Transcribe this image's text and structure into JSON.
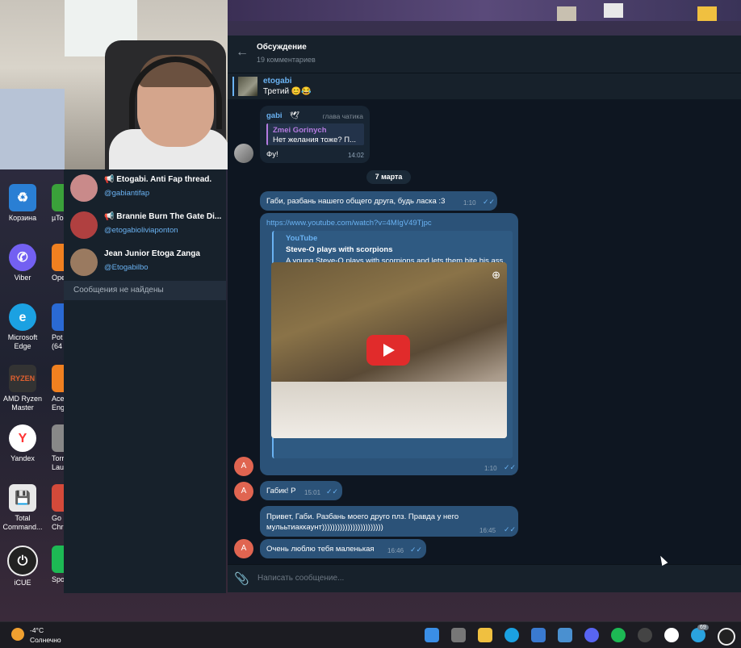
{
  "desktop": {
    "icons": [
      {
        "label": "Корзина",
        "icon": "recycle-bin-icon",
        "color": "#2a7fd4"
      },
      {
        "label": "Viber",
        "icon": "viber-icon",
        "color": "#7360f2"
      },
      {
        "label": "Microsoft Edge",
        "icon": "edge-icon",
        "color": "#1ba1e2"
      },
      {
        "label": "AMD Ryzen Master",
        "icon": "amd-ryzen-icon",
        "color": "#333333"
      },
      {
        "label": "Yandex",
        "icon": "yandex-icon",
        "color": "#ffffff"
      },
      {
        "label": "Total Command...",
        "icon": "total-commander-icon",
        "color": "#e8e8e8"
      },
      {
        "label": "iCUE",
        "icon": "icue-icon",
        "color": "#222222"
      }
    ],
    "partial_icons": [
      {
        "label": "µTo",
        "color": "#3aa13a"
      },
      {
        "label": "Ope",
        "color": "#f08020"
      },
      {
        "label": "Pot (64",
        "color": "#2a6ad4"
      },
      {
        "label": "AceE Eng",
        "color": "#f08020"
      },
      {
        "label": "Torr Laun",
        "color": "#888888"
      },
      {
        "label": "Go Chr",
        "color": "#d44a3a"
      },
      {
        "label": "Spo",
        "color": "#1db954"
      }
    ]
  },
  "search_panel": {
    "results": [
      {
        "name": "📢 Etogabi. Anti Fap thread.",
        "handle": "@gabiantifap",
        "avatar_color": "#c98a8a"
      },
      {
        "name": "📢 Brannie Burn The Gate Di...",
        "handle": "@etogabioliviaponton",
        "avatar_color": "#b04040"
      },
      {
        "name": "Jean Junior Etoga Zanga",
        "handle": "@Etogabilbo",
        "avatar_color": "#9a7a60"
      }
    ],
    "no_results": "Сообщения не найдены"
  },
  "chat": {
    "title": "Обсуждение",
    "subtitle": "19 комментариев",
    "pinned": {
      "author": "etogabi",
      "text": "Третий 😊😂"
    },
    "reply_msg": {
      "author": "gabi",
      "role": "глава чатика",
      "quote_author": "Zmei Gorinych",
      "quote_text": "Нет желания тоже? П...",
      "text": "Фу!",
      "time": "14:02"
    },
    "date": "7 марта",
    "msg1": {
      "text": "Габи, разбань нашего общего друга, будь ласка :3",
      "time": "1:10"
    },
    "link_msg": {
      "url": "https://www.youtube.com/watch?v=4MIgV49Tjpc",
      "site": "YouTube",
      "title": "Steve-O plays with scorpions",
      "desc": "A young Steve-O plays with scorpions and lets them bite his ass. Clip from Steve-O: Out on Bail",
      "time": "1:10"
    },
    "msg3": {
      "text": "Габик! Р",
      "time": "15:01"
    },
    "msg4": {
      "text": "Привет, Габи. Разбань моего друго плз. Правда у него мулььтиаккаунт))))))))))))))))))))))))",
      "time": "16:45"
    },
    "msg5": {
      "text": "Очень люблю тебя маленькая",
      "time": "16:46"
    },
    "avatar_letter": "A",
    "input_placeholder": "Написать сообщение..."
  },
  "taskbar": {
    "weather_temp": "-4°C",
    "weather_text": "Солнечно",
    "telegram_badge": "69"
  }
}
